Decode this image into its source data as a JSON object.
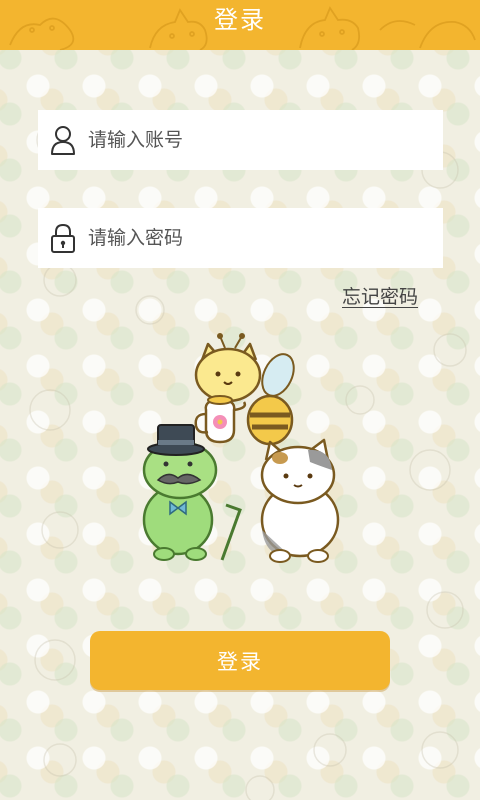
{
  "header": {
    "title": "登录"
  },
  "login_form": {
    "account_placeholder": "请输入账号",
    "password_placeholder": "请输入密码",
    "forgot_password_label": "忘记密码",
    "submit_label": "登录"
  },
  "icons": {
    "account": "user-outline-icon",
    "password": "padlock-icon"
  },
  "colors": {
    "accent": "#f3b52f",
    "background": "#f1efe2",
    "input_background": "#ffffff",
    "button_text": "#ffffff"
  }
}
